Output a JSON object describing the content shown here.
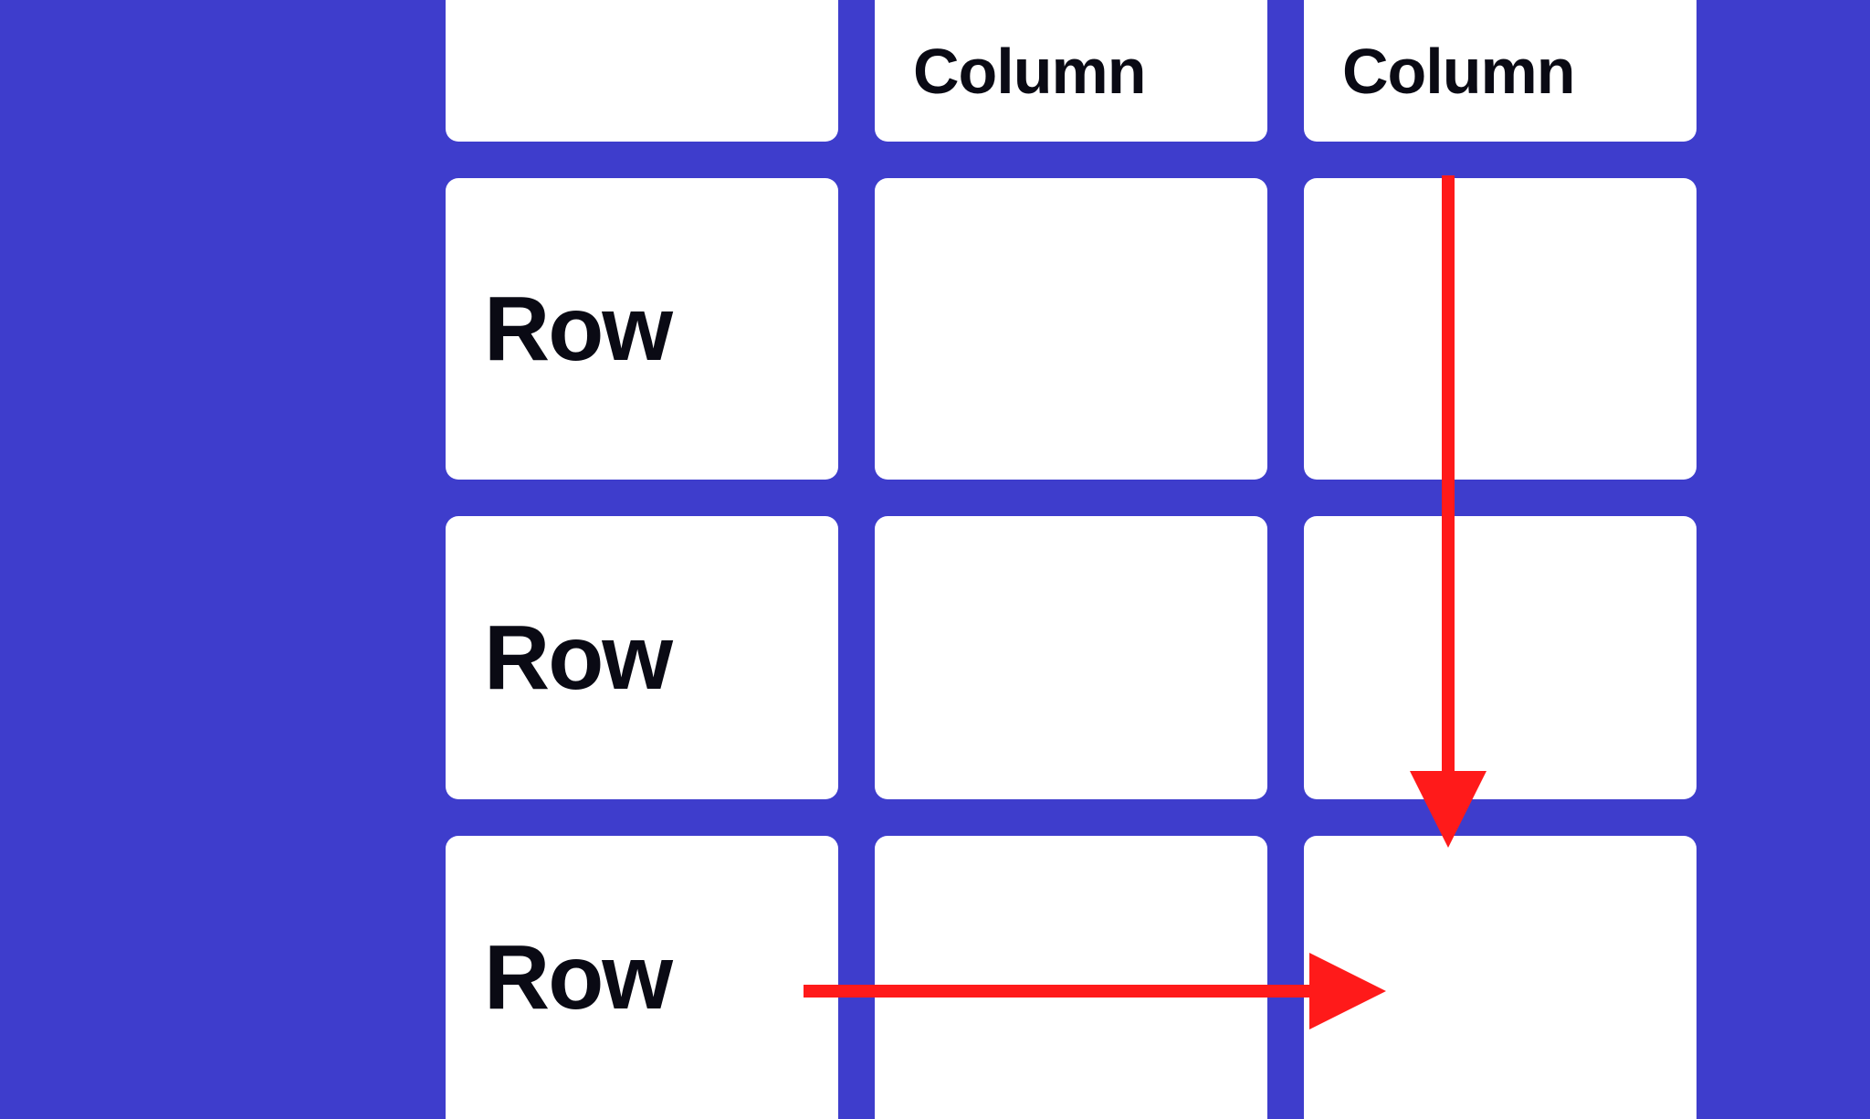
{
  "headers": {
    "col1": "",
    "col2": "Column",
    "col3": "Column"
  },
  "rows": [
    {
      "label": "Row"
    },
    {
      "label": "Row"
    },
    {
      "label": "Row"
    }
  ],
  "annotation": {
    "arrow_color": "#ff1a1a",
    "vertical_arrow": {
      "from": "col3_header",
      "to": "row3_col3"
    },
    "horizontal_arrow": {
      "from": "row3_label",
      "to": "row3_col3"
    }
  }
}
